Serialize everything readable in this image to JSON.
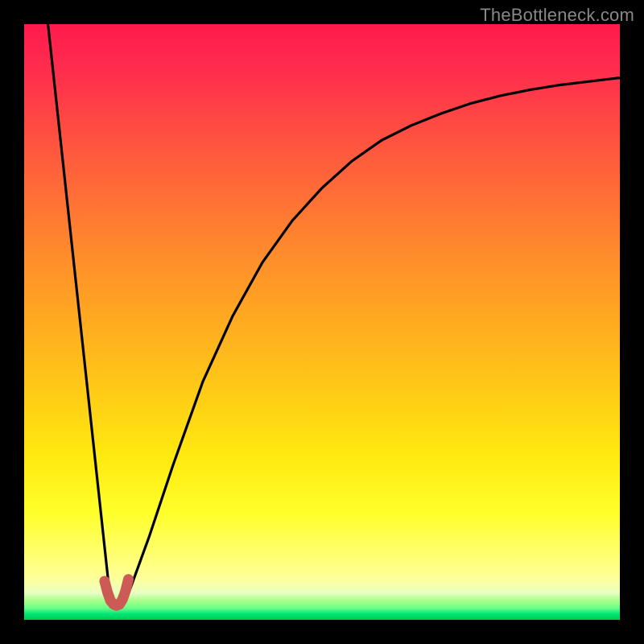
{
  "watermark": "TheBottleneck.com",
  "chart_data": {
    "type": "line",
    "title": "",
    "xlabel": "",
    "ylabel": "",
    "xlim": [
      0,
      100
    ],
    "ylim": [
      0,
      100
    ],
    "grid": false,
    "series": [
      {
        "name": "left-falling-line",
        "x": [
          4,
          14.5
        ],
        "y": [
          100,
          3
        ]
      },
      {
        "name": "right-rising-curve",
        "x": [
          17,
          21,
          25,
          30,
          35,
          40,
          45,
          50,
          55,
          60,
          65,
          70,
          75,
          80,
          85,
          90,
          95,
          100
        ],
        "y": [
          3,
          14,
          26,
          40,
          51,
          60,
          67,
          72.5,
          77,
          80.5,
          83,
          85,
          86.7,
          88,
          89,
          89.8,
          90.4,
          91
        ]
      },
      {
        "name": "bottom-marker",
        "x": [
          13.5,
          14,
          14.5,
          15,
          15.5,
          16,
          16.5,
          17,
          17.5
        ],
        "y": [
          6.5,
          4.6,
          3.2,
          2.6,
          2.4,
          2.6,
          3.4,
          4.8,
          6.8
        ]
      }
    ],
    "annotations": []
  },
  "style": {
    "curve_stroke": "#000000",
    "curve_width": 3.2,
    "marker_stroke": "#cc5a55",
    "marker_width": 13
  }
}
